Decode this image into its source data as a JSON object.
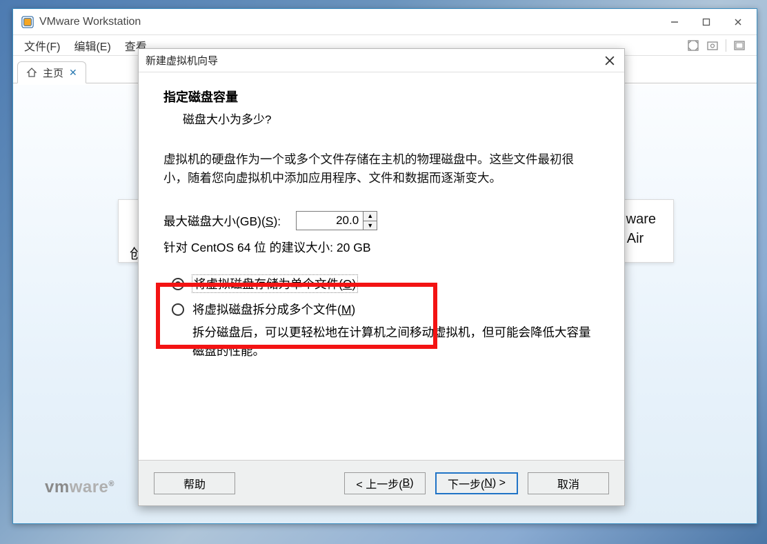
{
  "window": {
    "title": "VMware Workstation"
  },
  "menu": {
    "file": "文件(F)",
    "edit": "编辑(E)",
    "view": "查看"
  },
  "tab": {
    "label": "主页"
  },
  "background": {
    "create_label": "创建新的",
    "right_line1": "Mware",
    "right_line2": "Air",
    "vmware_logo": "vmware"
  },
  "dialog": {
    "title": "新建虚拟机向导",
    "heading": "指定磁盘容量",
    "subheading": "磁盘大小为多少?",
    "description": "虚拟机的硬盘作为一个或多个文件存储在主机的物理磁盘中。这些文件最初很小，随着您向虚拟机中添加应用程序、文件和数据而逐渐变大。",
    "size_label": "最大磁盘大小(GB)(S):",
    "size_value": "20.0",
    "recommended": "针对 CentOS 64 位 的建议大小: 20 GB",
    "radio_single": "将虚拟磁盘存储为单个文件(O)",
    "radio_split": "将虚拟磁盘拆分成多个文件(M)",
    "split_note": "拆分磁盘后，可以更轻松地在计算机之间移动虚拟机，但可能会降低大容量磁盘的性能。"
  },
  "buttons": {
    "help": "帮助",
    "back": "< 上一步(B)",
    "next": "下一步(N) >",
    "cancel": "取消"
  }
}
